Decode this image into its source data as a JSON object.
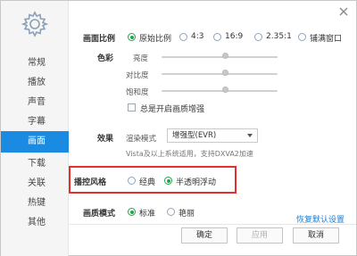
{
  "sidebar": {
    "items": [
      {
        "label": "常规"
      },
      {
        "label": "播放"
      },
      {
        "label": "声音"
      },
      {
        "label": "字幕"
      },
      {
        "label": "画面",
        "active": true
      },
      {
        "label": "下载"
      },
      {
        "label": "关联"
      },
      {
        "label": "热键"
      },
      {
        "label": "其他"
      }
    ]
  },
  "picture": {
    "ratio_label": "画面比例",
    "ratio_options": [
      "原始比例",
      "4:3",
      "16:9",
      "2.35:1",
      "铺满窗口"
    ],
    "ratio_selected": "原始比例",
    "color_label": "色彩",
    "brightness_label": "亮度",
    "contrast_label": "对比度",
    "saturation_label": "饱和度",
    "brightness_level": 0.55,
    "contrast_level": 0.55,
    "saturation_level": 0.55,
    "always_enhance_label": "总是开启画质增强",
    "always_enhance_checked": false,
    "effect_label": "效果",
    "render_mode_label": "渲染模式",
    "render_mode_value": "增强型(EVR)",
    "render_note": "Vista及以上系统适用，支持DXVA2加速",
    "control_style_label": "播控风格",
    "control_style_options": [
      "经典",
      "半透明浮动"
    ],
    "control_style_selected": "半透明浮动",
    "quality_mode_label": "画质模式",
    "quality_mode_options": [
      "标准",
      "艳丽"
    ],
    "quality_mode_selected": "标准",
    "restore_defaults_label": "恢复默认设置"
  },
  "footer": {
    "ok_label": "确定",
    "apply_label": "应用",
    "cancel_label": "取消"
  },
  "colors": {
    "accent": "#1a8be0",
    "radio_on": "#1fa84a",
    "highlight_border": "#e3302c",
    "link": "#1a7fd6"
  }
}
